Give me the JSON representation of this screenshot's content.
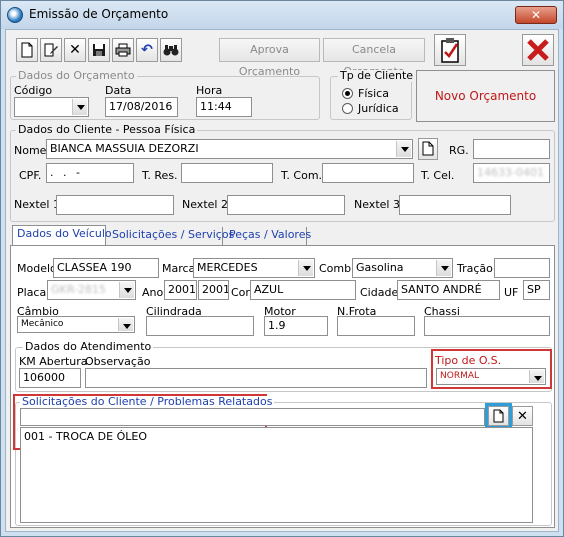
{
  "window": {
    "title": "Emissão de Orçamento"
  },
  "toolbar": {
    "aprova_label": "Aprova Orçamento",
    "cancela_label": "Cancela Orçamento"
  },
  "orcamento": {
    "group_label": "Dados do Orçamento",
    "codigo_label": "Código",
    "codigo_value": "",
    "data_label": "Data",
    "data_value": "17/08/2016",
    "hora_label": "Hora",
    "hora_value": "11:44"
  },
  "tp_cliente": {
    "group_label": "Tp de Cliente",
    "fisica_label": "Física",
    "juridica_label": "Jurídica",
    "selected": "Física"
  },
  "novo_orcamento_label": "Novo Orçamento",
  "cliente": {
    "group_label": "Dados do Cliente  - Pessoa Física",
    "nome_label": "Nome",
    "nome_value": "BIANCA MASSUIA DEZORZI",
    "rg_label": "RG.",
    "rg_value": "",
    "cpf_label": "CPF.",
    "cpf_value": ". . -",
    "tres_label": "T. Res.",
    "tres_value": "",
    "tcom_label": "T. Com.",
    "tcom_value": "",
    "tcel_label": "T. Cel.",
    "tcel_value": "14633-0401",
    "nextel1_label": "Nextel 1",
    "nextel2_label": "Nextel 2",
    "nextel3_label": "Nextel 3"
  },
  "tabs": [
    {
      "label": "Dados do Veículo"
    },
    {
      "label": "Solicitações / Serviços"
    },
    {
      "label": "Peças / Valores"
    }
  ],
  "veiculo": {
    "modelo_label": "Modelo",
    "modelo_value": "CLASSEA 190",
    "marca_label": "Marca",
    "marca_value": "MERCEDES",
    "comb_label": "Comb.",
    "comb_value": "Gasolina",
    "tracao_label": "Tração",
    "tracao_value": "",
    "placa_label": "Placa",
    "placa_value": "GKR-2815",
    "ano_label": "Ano",
    "ano_value1": "2001",
    "ano_value2": "2001",
    "cor_label": "Cor",
    "cor_value": "AZUL",
    "cidade_label": "Cidade",
    "cidade_value": "SANTO ANDRÉ",
    "uf_label": "UF",
    "uf_value": "SP",
    "cambio_label": "Câmbio",
    "cambio_value": "Mecânico",
    "cilindrada_label": "Cilindrada",
    "cilindrada_value": "",
    "motor_label": "Motor",
    "motor_value": "1.9",
    "nfrota_label": "N.Frota",
    "nfrota_value": "",
    "chassi_label": "Chassi",
    "chassi_value": ""
  },
  "atendimento": {
    "group_label": "Dados do Atendimento",
    "km_label": "KM Abertura",
    "km_value": "106000",
    "obs_label": "Observação",
    "obs_value": "",
    "tipo_os_label": "Tipo de O.S.",
    "tipo_os_value": "NORMAL"
  },
  "solicitacoes": {
    "group_label": "Solicitações do Cliente / Problemas Relatados",
    "input_value": "",
    "items": [
      "001 - TROCA DE ÓLEO"
    ]
  },
  "colors": {
    "highlight_red": "#d23737",
    "highlight_blue": "#2f9ed8",
    "link_blue": "#1e3fae",
    "new_budget_red": "#c01818"
  }
}
